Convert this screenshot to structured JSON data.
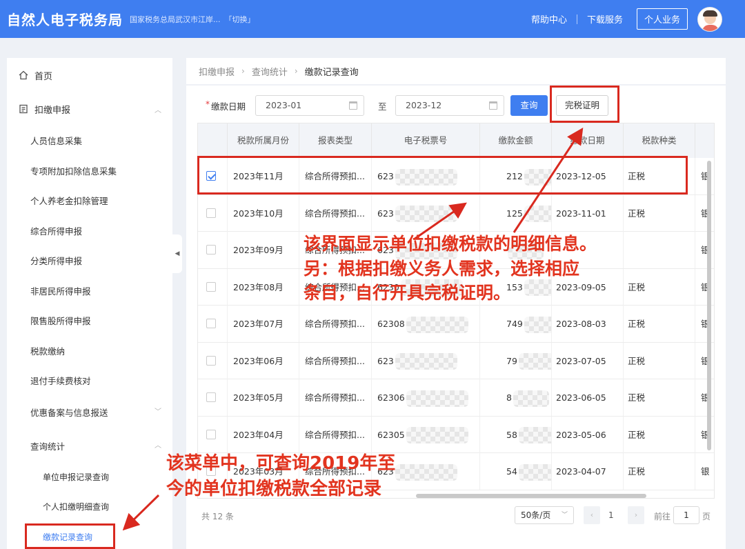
{
  "header": {
    "app_title": "自然人电子税务局",
    "org": "国家税务总局武汉市江岸...",
    "switch_label": "「切换」",
    "help": "帮助中心",
    "download": "下载服务",
    "personal": "个人业务"
  },
  "sidebar": {
    "home": "首页",
    "withholding": "扣缴申报",
    "items": [
      "人员信息采集",
      "专项附加扣除信息采集",
      "个人养老金扣除管理",
      "综合所得申报",
      "分类所得申报",
      "非居民所得申报",
      "限售股所得申报",
      "税款缴纳",
      "退付手续费核对"
    ],
    "preferential": "优惠备案与信息报送",
    "query_stats": "查询统计",
    "query_sub": [
      "单位申报记录查询",
      "个人扣缴明细查询",
      "缴款记录查询"
    ]
  },
  "breadcrumb": [
    "扣缴申报",
    "查询统计",
    "缴款记录查询"
  ],
  "filter": {
    "required_mark": "*",
    "label": "缴款日期",
    "from": "2023-01",
    "to_label": "至",
    "to": "2023-12",
    "query_button": "查询",
    "cert_button": "完税证明"
  },
  "table": {
    "columns": [
      "税款所属月份",
      "报表类型",
      "电子税票号",
      "缴款金额",
      "缴款日期",
      "税款种类"
    ],
    "rows": [
      {
        "checked": true,
        "month": "2023年11月",
        "type": "综合所得预扣...",
        "ticket": "623",
        "amount": "212",
        "date": "2023-12-05",
        "kind": "正税",
        "extra": "银"
      },
      {
        "checked": false,
        "month": "2023年10月",
        "type": "综合所得预扣...",
        "ticket": "623",
        "amount": "125",
        "date": "2023-11-01",
        "kind": "正税",
        "extra": "银"
      },
      {
        "checked": false,
        "month": "2023年09月",
        "type": "综合所得预扣...",
        "ticket": "623",
        "amount": "",
        "date": "",
        "kind": "",
        "extra": "银"
      },
      {
        "checked": false,
        "month": "2023年08月",
        "type": "综合所得预扣...",
        "ticket": "6230",
        "amount": "153",
        "date": "2023-09-05",
        "kind": "正税",
        "extra": "银"
      },
      {
        "checked": false,
        "month": "2023年07月",
        "type": "综合所得预扣...",
        "ticket": "62308",
        "amount": "749",
        "date": "2023-08-03",
        "kind": "正税",
        "extra": "银"
      },
      {
        "checked": false,
        "month": "2023年06月",
        "type": "综合所得预扣...",
        "ticket": "623",
        "amount": "79",
        "date": "2023-07-05",
        "kind": "正税",
        "extra": "银"
      },
      {
        "checked": false,
        "month": "2023年05月",
        "type": "综合所得预扣...",
        "ticket": "62306",
        "amount": "8",
        "date": "2023-06-05",
        "kind": "正税",
        "extra": "银"
      },
      {
        "checked": false,
        "month": "2023年04月",
        "type": "综合所得预扣...",
        "ticket": "62305",
        "amount": "58",
        "date": "2023-05-06",
        "kind": "正税",
        "extra": "银"
      },
      {
        "checked": false,
        "month": "2023年03月",
        "type": "综合所得预扣...",
        "ticket": "623",
        "amount": "54",
        "date": "2023-04-07",
        "kind": "正税",
        "extra": "银"
      }
    ]
  },
  "pagination": {
    "total": "共 12 条",
    "page_size": "50条/页",
    "prev": "‹",
    "current": "1",
    "next": "›",
    "goto_label": "前往",
    "goto_value": "1",
    "page_unit": "页"
  },
  "annotations": {
    "right_line1": "该界面显示单位扣缴税款的明细信息。",
    "right_line2": "另：根据扣缴义务人需求，选择相应",
    "right_line3": "条目，自行开具完税证明。",
    "left_line1": "该菜单中，可查询2019年至",
    "left_line2": "今的单位扣缴税款全部记录"
  },
  "colors": {
    "brand": "#3f7ef0",
    "annotation": "#e2341f"
  }
}
